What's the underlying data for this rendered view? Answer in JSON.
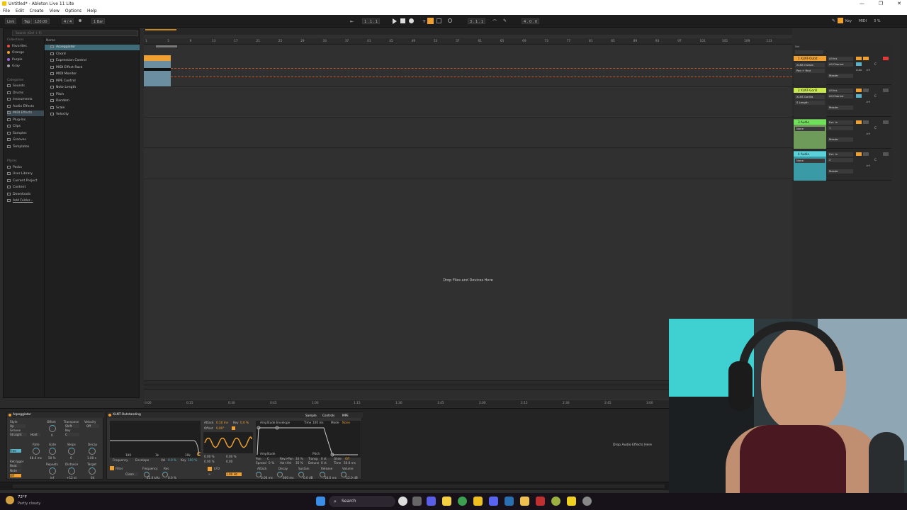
{
  "window": {
    "title": "Untitled* - Ableton Live 11 Lite",
    "controls": [
      "—",
      "❐",
      "✕"
    ]
  },
  "menu": [
    "File",
    "Edit",
    "Create",
    "View",
    "Options",
    "Help"
  ],
  "controlbar": {
    "link": "Link",
    "tap": "Tap",
    "tempo": "120.00",
    "signature": "4 / 4",
    "quantize": "1 Bar",
    "position": "1 . 1 . 1",
    "position2": "3 . 1 . 1",
    "loop_length": "4 . 0 . 0",
    "key": "Key",
    "midi": "MIDI",
    "cpu": "3 %"
  },
  "browser": {
    "search_placeholder": "Search (Ctrl + F)",
    "collections_header": "Collections",
    "collections": [
      {
        "label": "Favorites",
        "color": "#e84a3c"
      },
      {
        "label": "Orange",
        "color": "#f0a030"
      },
      {
        "label": "Purple",
        "color": "#a060e0"
      },
      {
        "label": "Gray",
        "color": "#9a9a9a"
      }
    ],
    "categories_header": "Categories",
    "categories": [
      "Sounds",
      "Drums",
      "Instruments",
      "Audio Effects",
      "MIDI Effects",
      "Plug-Ins",
      "Clips",
      "Samples",
      "Grooves",
      "Templates"
    ],
    "places_header": "Places",
    "places": [
      "Packs",
      "User Library",
      "Current Project",
      "Content",
      "Downloads",
      "Add Folder..."
    ],
    "name_header": "Name",
    "files": [
      "Arpeggiator",
      "Chord",
      "Expression Control",
      "MIDI Effect Rack",
      "MIDI Monitor",
      "MPE Control",
      "Note Length",
      "Pitch",
      "Random",
      "Scale",
      "Velocity"
    ]
  },
  "arrangement": {
    "bar_numbers": [
      "1",
      "5",
      "9",
      "13",
      "17",
      "21",
      "25",
      "29",
      "33",
      "37",
      "41",
      "45",
      "49",
      "53",
      "57",
      "61",
      "65",
      "69",
      "73",
      "77",
      "81",
      "85",
      "89",
      "93",
      "97",
      "101",
      "105",
      "109",
      "113"
    ],
    "drop_text": "Drop Files and Devices Here",
    "time_ruler": [
      "0:00",
      "0:15",
      "0:30",
      "0:45",
      "1:00",
      "1:15",
      "1:30",
      "1:45",
      "2:00",
      "2:15",
      "2:30",
      "2:45",
      "3:00"
    ]
  },
  "mixer": {
    "set_label": "Set",
    "tracks": [
      {
        "name": "1 XLNT-Outst",
        "color": "#f0a030",
        "input": "All Ins",
        "device": "XLNT-Outsta",
        "channel": "All Channe",
        "sub": "Pan + Rnd",
        "routing": "Master",
        "vol": "-inf",
        "pan": "C"
      },
      {
        "name": "2 XLNT-Gorill",
        "color": "#c8e850",
        "input": "All Ins",
        "device": "XLNT-Gorilla",
        "channel": "All Channe",
        "sub": "S Length",
        "routing": "Master",
        "vol": "-inf",
        "pan": "C"
      },
      {
        "name": "3 Audio",
        "color": "#6ee05a",
        "input": "Ext. In",
        "device": "None",
        "channel": "1",
        "sub": "",
        "routing": "Master",
        "vol": "-inf",
        "pan": "C"
      },
      {
        "name": "4 Audio",
        "color": "#5ad0d8",
        "input": "Ext. In",
        "device": "None",
        "channel": "2",
        "sub": "",
        "routing": "Master",
        "vol": "-inf",
        "pan": "C"
      }
    ],
    "auto_label": "Auto",
    "off_label": "Off",
    "in_label": "In"
  },
  "detail": {
    "arp": {
      "title": "Arpeggiator",
      "style_label": "Style",
      "style": "Up",
      "groove_label": "Groove",
      "groove": "Straight",
      "hold": "Hold",
      "offset_label": "Offset",
      "offset": "0",
      "transpose_label": "Transpose",
      "transpose": "Shift",
      "key_label": "Key",
      "key": "C",
      "velocity_label": "Velocity",
      "velocity": "Off",
      "rate_label": "Rate",
      "rate": "48.4 ms",
      "free": "Free",
      "gate_label": "Gate",
      "gate": "50 %",
      "steps_label": "Steps",
      "steps": "0",
      "decay_label": "Decay",
      "decay": "1.00 s",
      "retrigger_label": "Retrigger",
      "retrig_beat": "Beat",
      "retrig_note": "Note",
      "retrig_off": "Off",
      "repeats_label": "Repeats",
      "repeats": "inf",
      "distance_label": "Distance",
      "distance": "+12 st",
      "target_label": "Target",
      "target": "64"
    },
    "synth": {
      "title": "XLNT-Outstanding",
      "tabs": [
        "Sample",
        "Controls",
        "MPE"
      ],
      "attack_label": "Attack",
      "attack": "0.10 ms",
      "key_label": "Key",
      "key": "0.0 %",
      "offset_label": "Offset",
      "offset": "0.00°",
      "freq_labels": [
        "100",
        "1k",
        "10k"
      ],
      "freq_env": "Frequency",
      "envelope_label": "Envelope",
      "vel_label": "Vel",
      "vel": "0.0 %",
      "keypct_label": "Key",
      "keypct": "100 %",
      "vel2": "0.00 %",
      "pitch2": "0.00 %",
      "pan2": "0.00 %",
      "filter2": "0.00",
      "filter_label": "Filter",
      "filter_type": "Clean",
      "frequency_label": "Frequency",
      "frequency": "22.0 kHz",
      "res_label": "Res",
      "res": "0.0 %",
      "lfo_label": "LFO",
      "lfo_rate": "1.00 Hz",
      "amp_env_title": "Amplitude Envelope",
      "time_label": "Time",
      "time": "100 ms",
      "mode_label": "Mode",
      "mode": "None",
      "amplitude_label": "Amplitude",
      "pitch_label": "Pitch",
      "pan_label": "Pan",
      "pan": "C",
      "rev_label": "Rev>Pan",
      "rev": "33 %",
      "spread_label": "Spread",
      "spread": "0 %",
      "volvel_label": "Vol<Vel",
      "volvel": "35 %",
      "transp_label": "Transp",
      "transp": "0 st",
      "detune_label": "Detune",
      "detune": "0 ct",
      "glide_label": "Glide",
      "glide": "Off",
      "gtime_label": "Time",
      "gtime": "50.0 ms",
      "adsr_labels": [
        "Attack",
        "Decay",
        "Sustain",
        "Release",
        "Volume"
      ],
      "adsr_values": [
        "0.00 ms",
        "600 ms",
        "0.0 dB",
        "50.0 ms",
        "-12.0 dB"
      ]
    },
    "drop_audio": "Drop Audio Effects Here"
  },
  "taskbar": {
    "weather_temp": "72°F",
    "weather_desc": "Partly cloudy",
    "search_placeholder": "Search"
  },
  "colors": {
    "accent": "#f0a030",
    "clip_blue": "#6b8fa0",
    "track3": "#6ee05a",
    "track4": "#5ad0d8"
  }
}
